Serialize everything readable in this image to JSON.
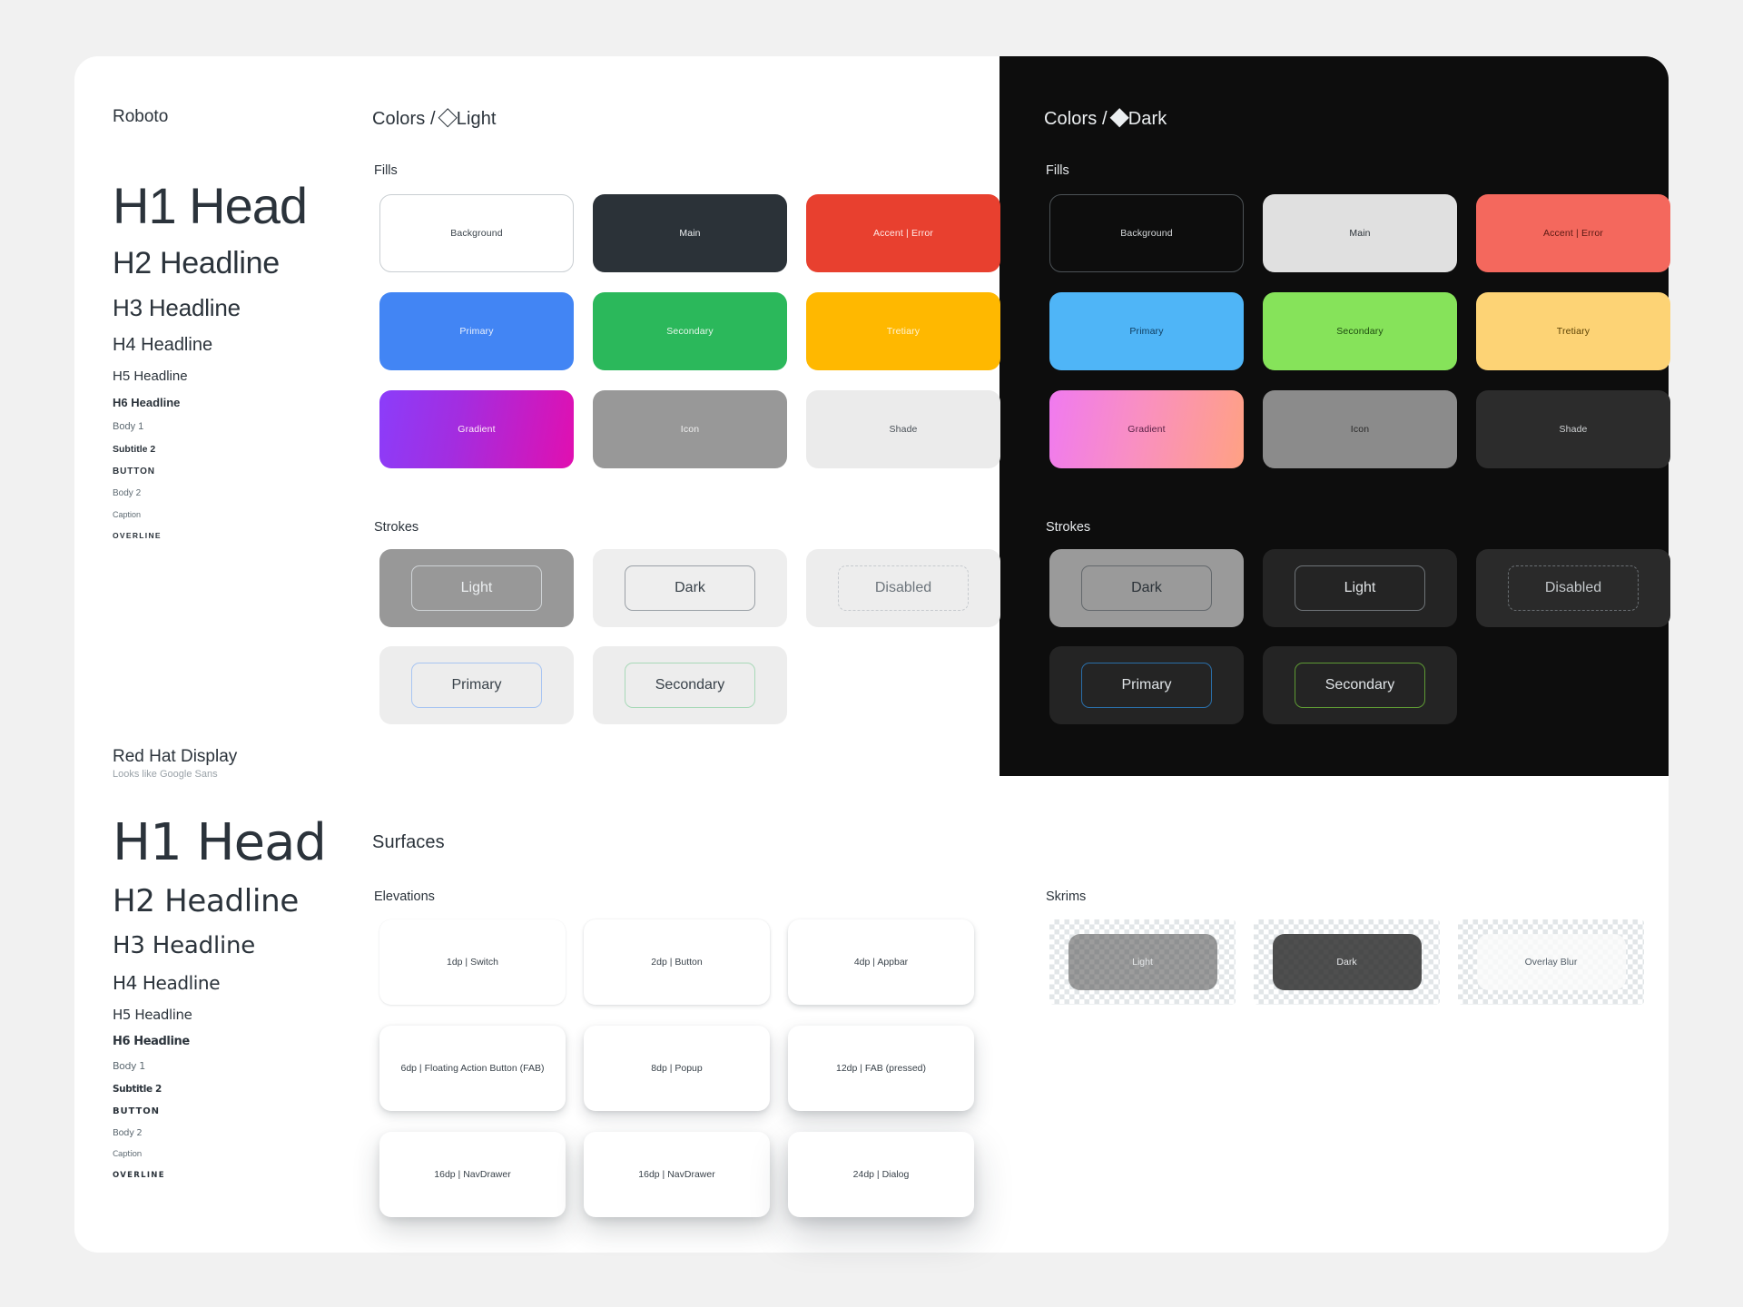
{
  "typography": {
    "roboto": {
      "font_name": "Roboto",
      "subtitle": "",
      "scale": [
        {
          "label": "H1 Head",
          "style": "t-h1"
        },
        {
          "label": "H2 Headline",
          "style": "t-h2"
        },
        {
          "label": "H3 Headline",
          "style": "t-h3"
        },
        {
          "label": "H4 Headline",
          "style": "t-h4"
        },
        {
          "label": "H5 Headline",
          "style": "t-h5"
        },
        {
          "label": "H6 Headline",
          "style": "t-h6"
        },
        {
          "label": "Body 1",
          "style": "t-b1"
        },
        {
          "label": "Subtitle 2",
          "style": "t-s2"
        },
        {
          "label": "BUTTON",
          "style": "t-btn"
        },
        {
          "label": "Body 2",
          "style": "t-b2"
        },
        {
          "label": "Caption",
          "style": "t-cap"
        },
        {
          "label": "OVERLINE",
          "style": "t-ovl"
        }
      ]
    },
    "redhat": {
      "font_name": "Red Hat Display",
      "subtitle": "Looks like Google Sans",
      "scale": [
        {
          "label": "H1 Head",
          "style": "t-h1"
        },
        {
          "label": "H2 Headline",
          "style": "t-h2"
        },
        {
          "label": "H3 Headline",
          "style": "t-h3"
        },
        {
          "label": "H4 Headline",
          "style": "t-h4"
        },
        {
          "label": "H5 Headline",
          "style": "t-h5"
        },
        {
          "label": "H6 Headline",
          "style": "t-h6"
        },
        {
          "label": "Body 1",
          "style": "t-b1"
        },
        {
          "label": "Subtitle 2",
          "style": "t-s2"
        },
        {
          "label": "BUTTON",
          "style": "t-btn"
        },
        {
          "label": "Body 2",
          "style": "t-b2"
        },
        {
          "label": "Caption",
          "style": "t-cap"
        },
        {
          "label": "OVERLINE",
          "style": "t-ovl"
        }
      ]
    }
  },
  "colors_light": {
    "title_prefix": "Colors /",
    "title_mode": "Light",
    "mode_icon": "diamond-outline-icon",
    "fills_heading": "Fills",
    "strokes_heading": "Strokes",
    "fills": [
      {
        "label": "Background",
        "fill": "#ffffff",
        "text": "#39424a",
        "border": "#c9ced2"
      },
      {
        "label": "Main",
        "fill": "#2b3238",
        "text": "#eef1f3",
        "border": ""
      },
      {
        "label": "Accent | Error",
        "fill": "#e8402f",
        "text": "#ffe9e6",
        "border": ""
      },
      {
        "label": "Primary",
        "fill": "#4285f4",
        "text": "#e9f0fd",
        "border": ""
      },
      {
        "label": "Secondary",
        "fill": "#2bb85b",
        "text": "#e7f7ec",
        "border": ""
      },
      {
        "label": "Tretiary",
        "fill": "#ffb800",
        "text": "#fff4d6",
        "border": ""
      },
      {
        "label": "Gradient",
        "fill": "linear-gradient(100deg,#8b3dfa 0%,#a32de0 40%,#e10fb0 100%)",
        "text": "#fde9f8",
        "border": ""
      },
      {
        "label": "Icon",
        "fill": "#989898",
        "text": "#f0f0f0",
        "border": ""
      },
      {
        "label": "Shade",
        "fill": "#ebebeb",
        "text": "#4a5158",
        "border": ""
      }
    ],
    "strokes": [
      {
        "label": "Light",
        "plate": "#989898",
        "stroke": "#cfd3d6",
        "text": "#eceff1",
        "dashed": false
      },
      {
        "label": "Dark",
        "plate": "#eeeeee",
        "stroke": "#9aa0a6",
        "text": "#39424a",
        "dashed": false
      },
      {
        "label": "Disabled",
        "plate": "#ededed",
        "stroke": "#c6cace",
        "text": "#6d757c",
        "dashed": true
      },
      {
        "label": "Primary",
        "plate": "#ededed",
        "stroke": "#a8c5f2",
        "text": "#39424a",
        "dashed": false
      },
      {
        "label": "Secondary",
        "plate": "#ededed",
        "stroke": "#a8d9b8",
        "text": "#39424a",
        "dashed": false
      }
    ]
  },
  "colors_dark": {
    "title_prefix": "Colors /",
    "title_mode": "Dark",
    "mode_icon": "diamond-filled-icon",
    "fills_heading": "Fills",
    "strokes_heading": "Strokes",
    "fills": [
      {
        "label": "Background",
        "fill": "#0d0d0d",
        "text": "#d7dadc",
        "border": "#4c5256"
      },
      {
        "label": "Main",
        "fill": "#e0e0e0",
        "text": "#2b3238",
        "border": ""
      },
      {
        "label": "Accent | Error",
        "fill": "#f4685d",
        "text": "#5a1a14",
        "border": ""
      },
      {
        "label": "Primary",
        "fill": "#4fb5f7",
        "text": "#0f3b5c",
        "border": ""
      },
      {
        "label": "Secondary",
        "fill": "#86e35a",
        "text": "#1d4a10",
        "border": ""
      },
      {
        "label": "Tretiary",
        "fill": "#fdd375",
        "text": "#5c4205",
        "border": ""
      },
      {
        "label": "Gradient",
        "fill": "linear-gradient(100deg,#f07af0 0%,#f98fc2 45%,#ffa183 100%)",
        "text": "#5a2247",
        "border": ""
      },
      {
        "label": "Icon",
        "fill": "#8b8b8b",
        "text": "#2a2a2a",
        "border": ""
      },
      {
        "label": "Shade",
        "fill": "#2c2c2c",
        "text": "#cfd2d4",
        "border": ""
      }
    ],
    "strokes": [
      {
        "label": "Dark",
        "plate": "#9a9a9a",
        "stroke": "#63686c",
        "text": "#2b3238",
        "dashed": false
      },
      {
        "label": "Light",
        "plate": "#242424",
        "stroke": "#6f7478",
        "text": "#e2e5e7",
        "dashed": false
      },
      {
        "label": "Disabled",
        "plate": "#2a2a2a",
        "stroke": "#6a6f73",
        "text": "#c3c7ca",
        "dashed": true
      },
      {
        "label": "Primary",
        "plate": "#242424",
        "stroke": "#2a6ea8",
        "text": "#dfe3e6",
        "dashed": false
      },
      {
        "label": "Secondary",
        "plate": "#242424",
        "stroke": "#5e9a34",
        "text": "#dfe3e6",
        "dashed": false
      }
    ]
  },
  "surfaces": {
    "title": "Surfaces",
    "elevations_heading": "Elevations",
    "skrims_heading": "Skrims",
    "elevations": [
      {
        "label": "1dp | Switch"
      },
      {
        "label": "2dp | Button"
      },
      {
        "label": "4dp | Appbar"
      },
      {
        "label": "6dp | Floating Action Button (FAB)"
      },
      {
        "label": "8dp | Popup"
      },
      {
        "label": "12dp | FAB (pressed)"
      },
      {
        "label": "16dp | NavDrawer"
      },
      {
        "label": "16dp | NavDrawer"
      },
      {
        "label": "24dp | Dialog"
      }
    ],
    "skrims": [
      {
        "label": "Light",
        "fill": "rgba(75,75,75,0.55)",
        "text": "#e6e8ea"
      },
      {
        "label": "Dark",
        "fill": "rgba(40,40,40,0.82)",
        "text": "#e6e8ea"
      },
      {
        "label": "Overlay Blur",
        "fill": "rgba(250,250,250,0.82)",
        "text": "#55606a"
      }
    ]
  }
}
